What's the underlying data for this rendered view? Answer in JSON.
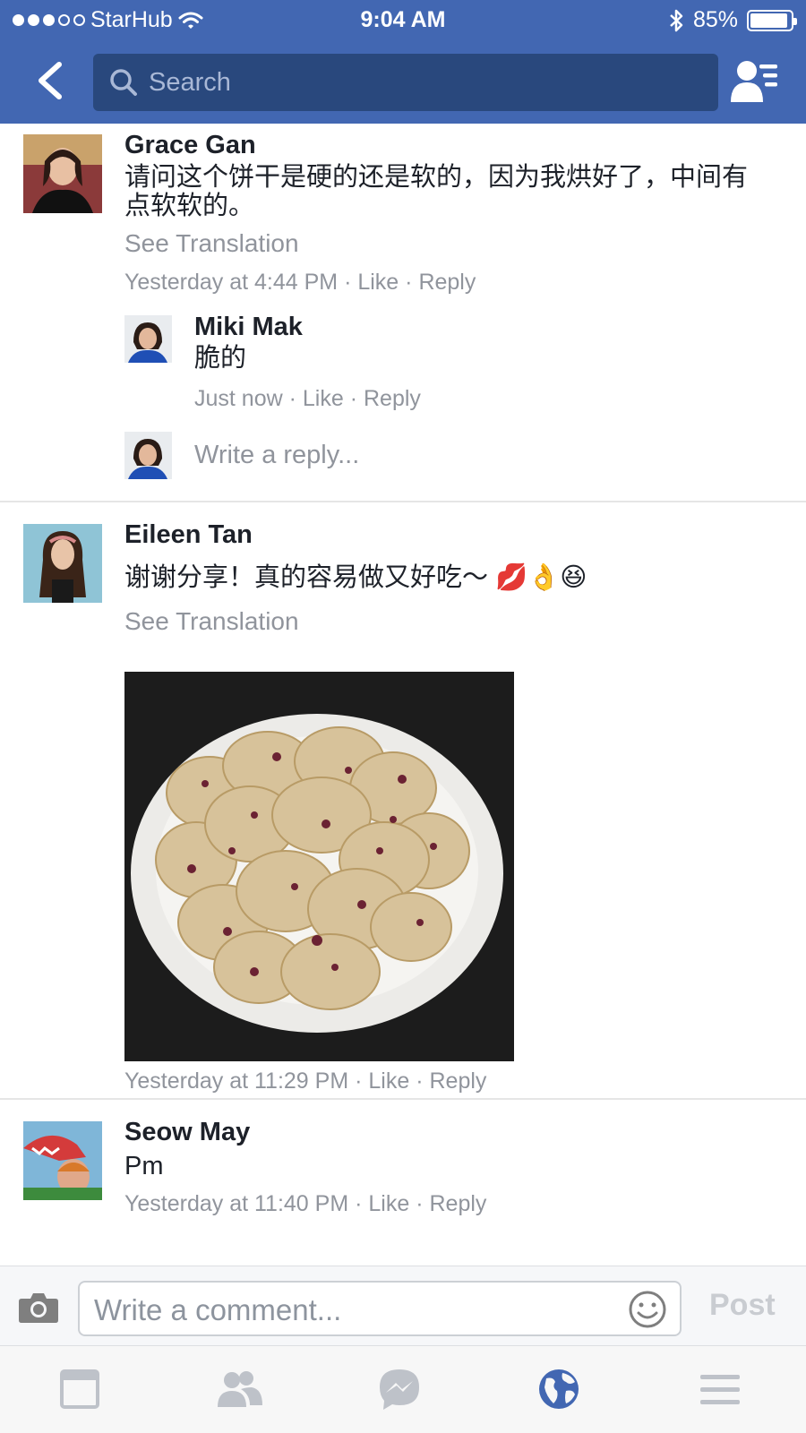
{
  "status_bar": {
    "carrier": "StarHub",
    "time": "9:04 AM",
    "battery": "85%"
  },
  "nav": {
    "search_placeholder": "Search"
  },
  "comments": [
    {
      "name": "Grace Gan",
      "text": "请问这个饼干是硬的还是软的，因为我烘好了，中间有点软软的。",
      "see_translation": "See Translation",
      "time": "Yesterday at 4:44 PM",
      "like": "Like",
      "reply": "Reply",
      "replies": [
        {
          "name": "Miki Mak",
          "text": "脆的",
          "time": "Just now",
          "like": "Like",
          "reply": "Reply"
        }
      ],
      "reply_placeholder": "Write a reply..."
    },
    {
      "name": "Eileen Tan",
      "text": "谢谢分享！真的容易做又好吃～ 💋👌😆",
      "see_translation": "See Translation",
      "time": "Yesterday at 11:29 PM",
      "like": "Like",
      "reply": "Reply"
    },
    {
      "name": "Seow May",
      "text": "Pm",
      "time": "Yesterday at 11:40 PM",
      "like": "Like",
      "reply": "Reply"
    }
  ],
  "composer": {
    "placeholder": "Write a comment...",
    "post_label": "Post"
  },
  "tabs": [
    "news-feed",
    "friends",
    "messenger",
    "notifications",
    "menu"
  ],
  "colors": {
    "brand": "#4267b2",
    "search_bg": "#29487d",
    "meta_text": "#90949c",
    "active_tab": "#4267b2",
    "inactive_tab": "#bec2c9"
  }
}
